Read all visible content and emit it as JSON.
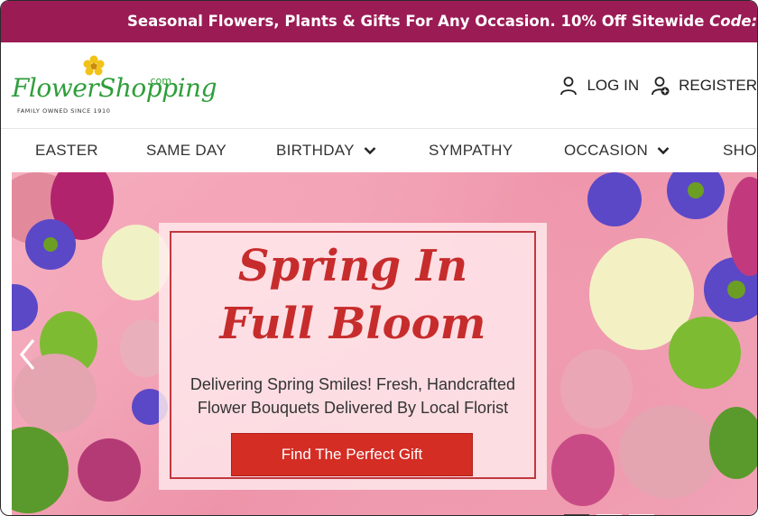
{
  "promo": {
    "text": "Seasonal Flowers, Plants & Gifts For Any Occasion. 10% Off Sitewide ",
    "code": "Code: BLOOM"
  },
  "logo": {
    "wordmark": "FlowerShopping",
    "suffix": ".com",
    "tagline": "FAMILY OWNED SINCE 1910"
  },
  "account": {
    "login_label": "LOG IN",
    "register_label": "REGISTER"
  },
  "nav": {
    "items": [
      {
        "label": "EASTER"
      },
      {
        "label": "SAME DAY"
      },
      {
        "label": "BIRTHDAY",
        "dropdown": true
      },
      {
        "label": "SYMPATHY"
      },
      {
        "label": "OCCASION",
        "dropdown": true
      },
      {
        "label": "SHOP"
      }
    ]
  },
  "hero": {
    "headline_line1": "Spring In",
    "headline_line2": "Full Bloom",
    "subtitle_line1": "Delivering Spring Smiles! Fresh, Handcrafted",
    "subtitle_line2": "Flower Bouquets Delivered By Local Florist",
    "cta_label": "Find The Perfect Gift"
  },
  "colors": {
    "promo_bg": "#9b1b55",
    "logo_green": "#2f9e3b",
    "headline_red": "#c72c2c",
    "cta_red": "#d42d24"
  }
}
